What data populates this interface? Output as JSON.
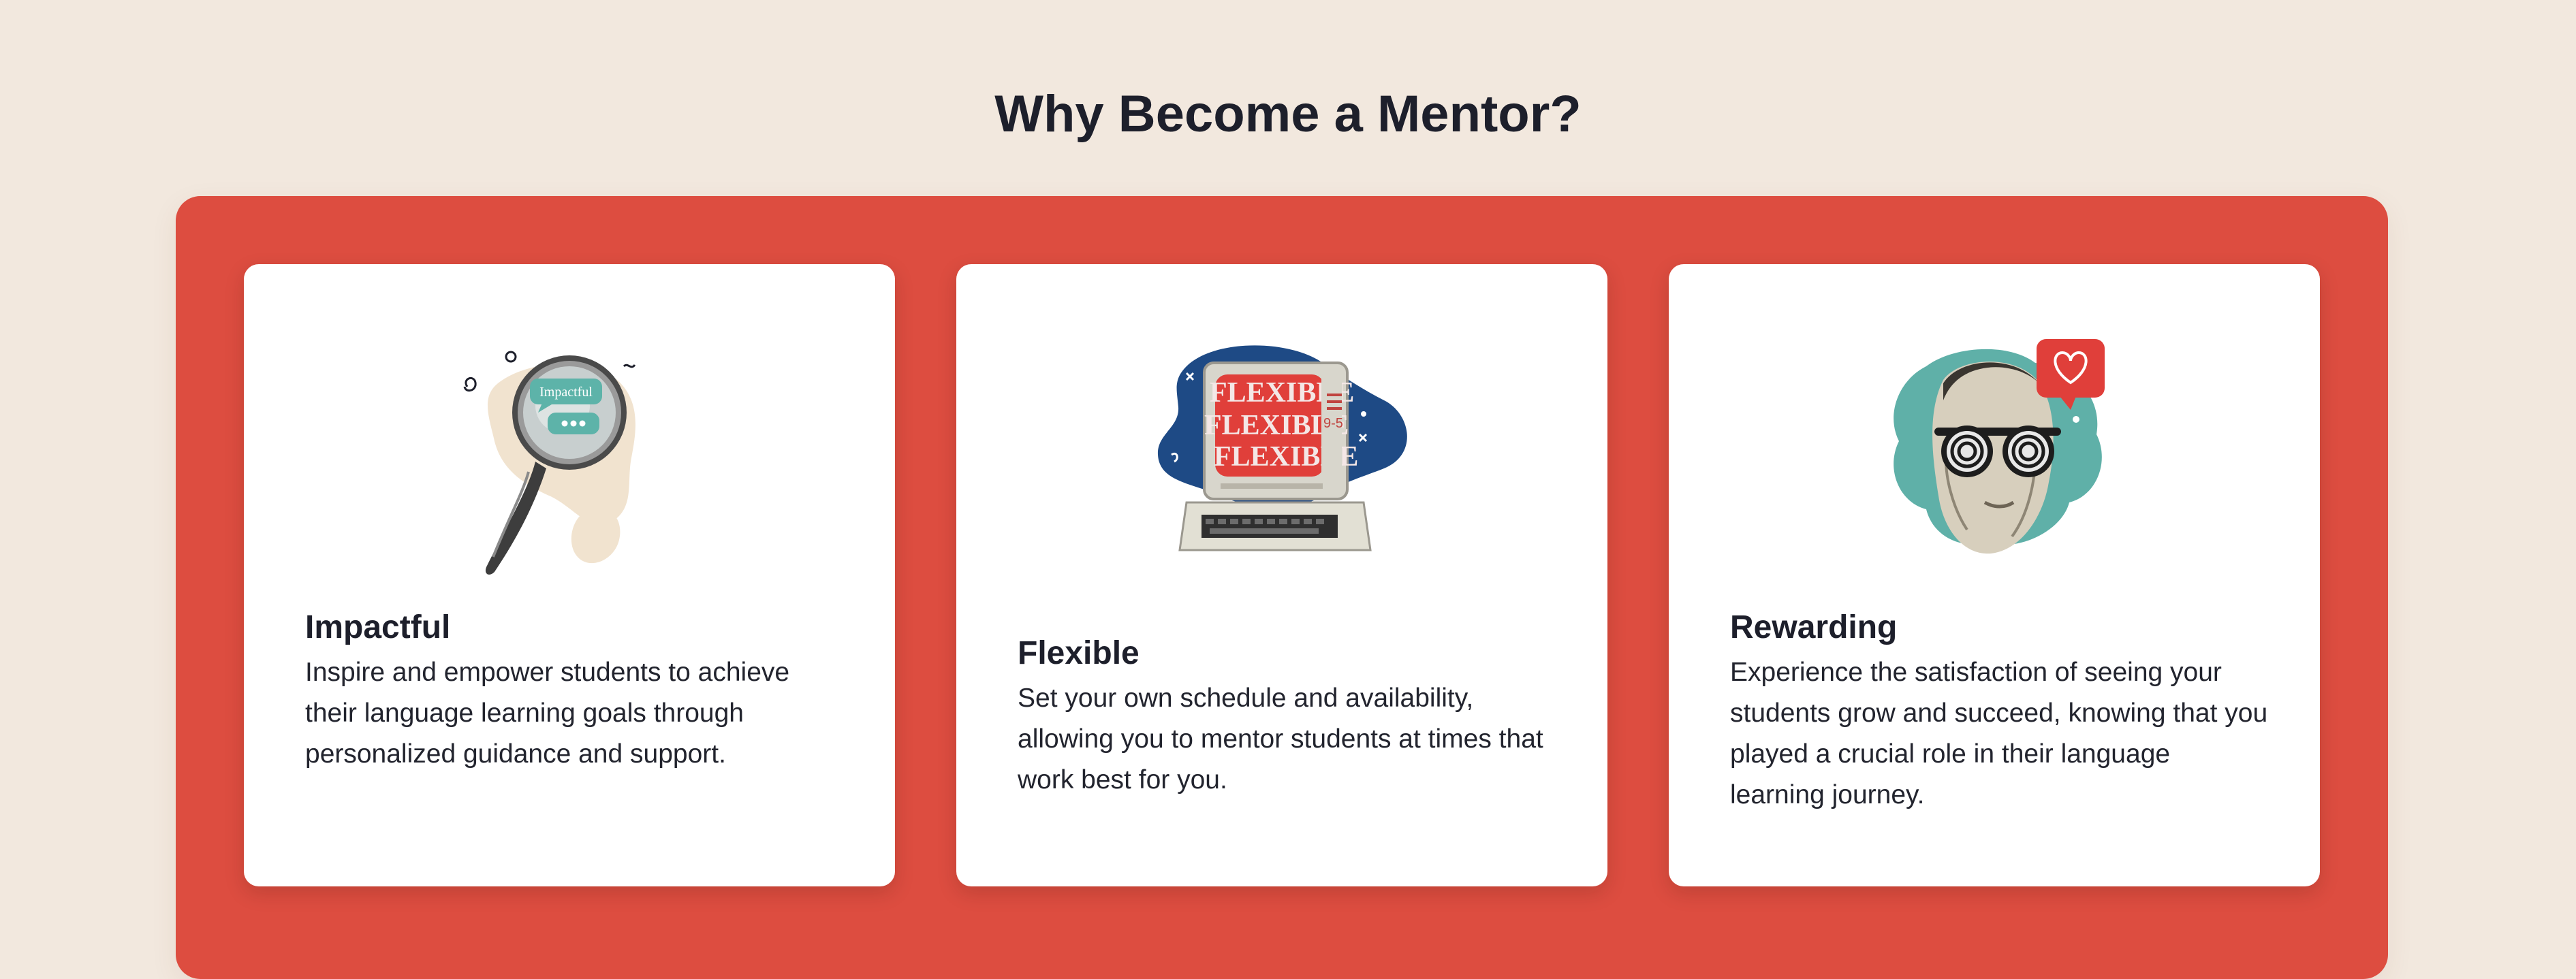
{
  "section": {
    "title": "Why Become a Mentor?"
  },
  "colors": {
    "background": "#f2e8de",
    "panel": "#dd4d40",
    "card": "#ffffff",
    "text": "#1d1f2b"
  },
  "cards": [
    {
      "title": "Impactful",
      "text": "Inspire and empower students to achieve their language learning goals through personalized guidance and support.",
      "icon": "magnifying-glass-icon",
      "illustration_label": "Impactful"
    },
    {
      "title": "Flexible",
      "text": "Set your own schedule and availability, allowing you to mentor students at times that work best for you.",
      "icon": "retro-computer-icon",
      "illustration_label": "9-5",
      "screen_text": "FLEXIBLE"
    },
    {
      "title": "Rewarding",
      "text": "Experience the satisfaction of seeing your students grow and succeed, knowing that you played a crucial role in their language learning journey.",
      "icon": "hypnotic-face-heart-icon"
    }
  ]
}
